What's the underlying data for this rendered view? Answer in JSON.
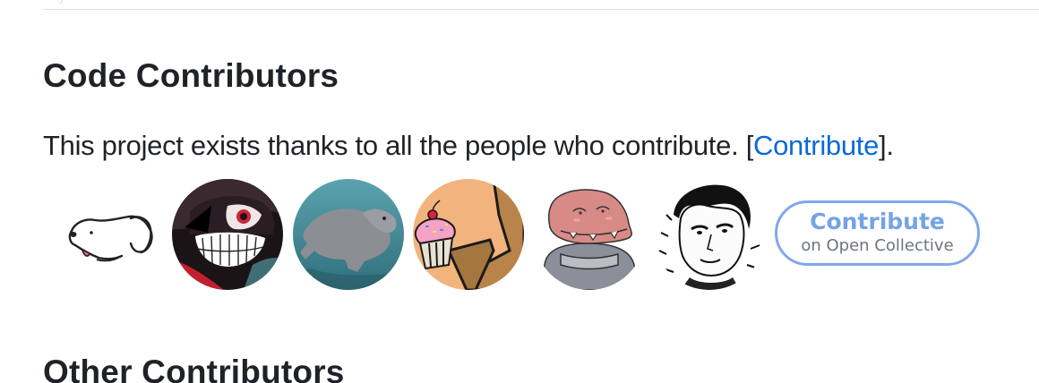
{
  "sections": {
    "code_contributors": {
      "title": "Code Contributors",
      "intro_before": "This project exists thanks to all the people who contribute. [",
      "intro_link": "Contribute",
      "intro_after": "]."
    },
    "other_contributors": {
      "title": "Other Contributors"
    }
  },
  "avatars": [
    {
      "icon": "dog-doodle-avatar"
    },
    {
      "icon": "masked-anime-avatar"
    },
    {
      "icon": "underwater-hippo-avatar"
    },
    {
      "icon": "cupcake-cartoon-avatar"
    },
    {
      "icon": "dinosaur-cartoon-avatar"
    },
    {
      "icon": "sketch-portrait-avatar"
    }
  ],
  "contribute_button": {
    "main": "Contribute",
    "sub": "on Open Collective"
  },
  "colors": {
    "link": "#0969da",
    "button_border": "#7fa8e8",
    "button_text": "#74a3e6",
    "heading": "#1f2328"
  }
}
